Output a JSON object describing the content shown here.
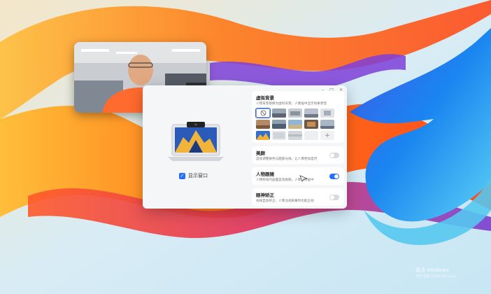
{
  "camera_preview": {
    "label": "camera-feed"
  },
  "window": {
    "controls": [
      "–",
      "□",
      "×"
    ]
  },
  "left_pane": {
    "show_window": {
      "label": "显示窗口",
      "checked": true
    }
  },
  "settings": {
    "background": {
      "title": "虚拟背景",
      "desc": "人物背景替换为虚拟背景，人像居中显示效果更佳"
    },
    "beauty": {
      "title": "美颜",
      "desc": "自动调整肤色与面部光线，让人像更加自然",
      "enabled": false
    },
    "follow": {
      "title": "人物跟随",
      "desc": "人物移动时画面自动跟随，人像始终居中",
      "enabled": true
    },
    "gaze": {
      "title": "眼神矫正",
      "desc": "视线自动矫正，人像注视屏幕时也能正视",
      "enabled": false
    }
  },
  "watermark": {
    "line1": "激活 Windows",
    "line2": "转到\"设置\"以激活 Windows。"
  }
}
